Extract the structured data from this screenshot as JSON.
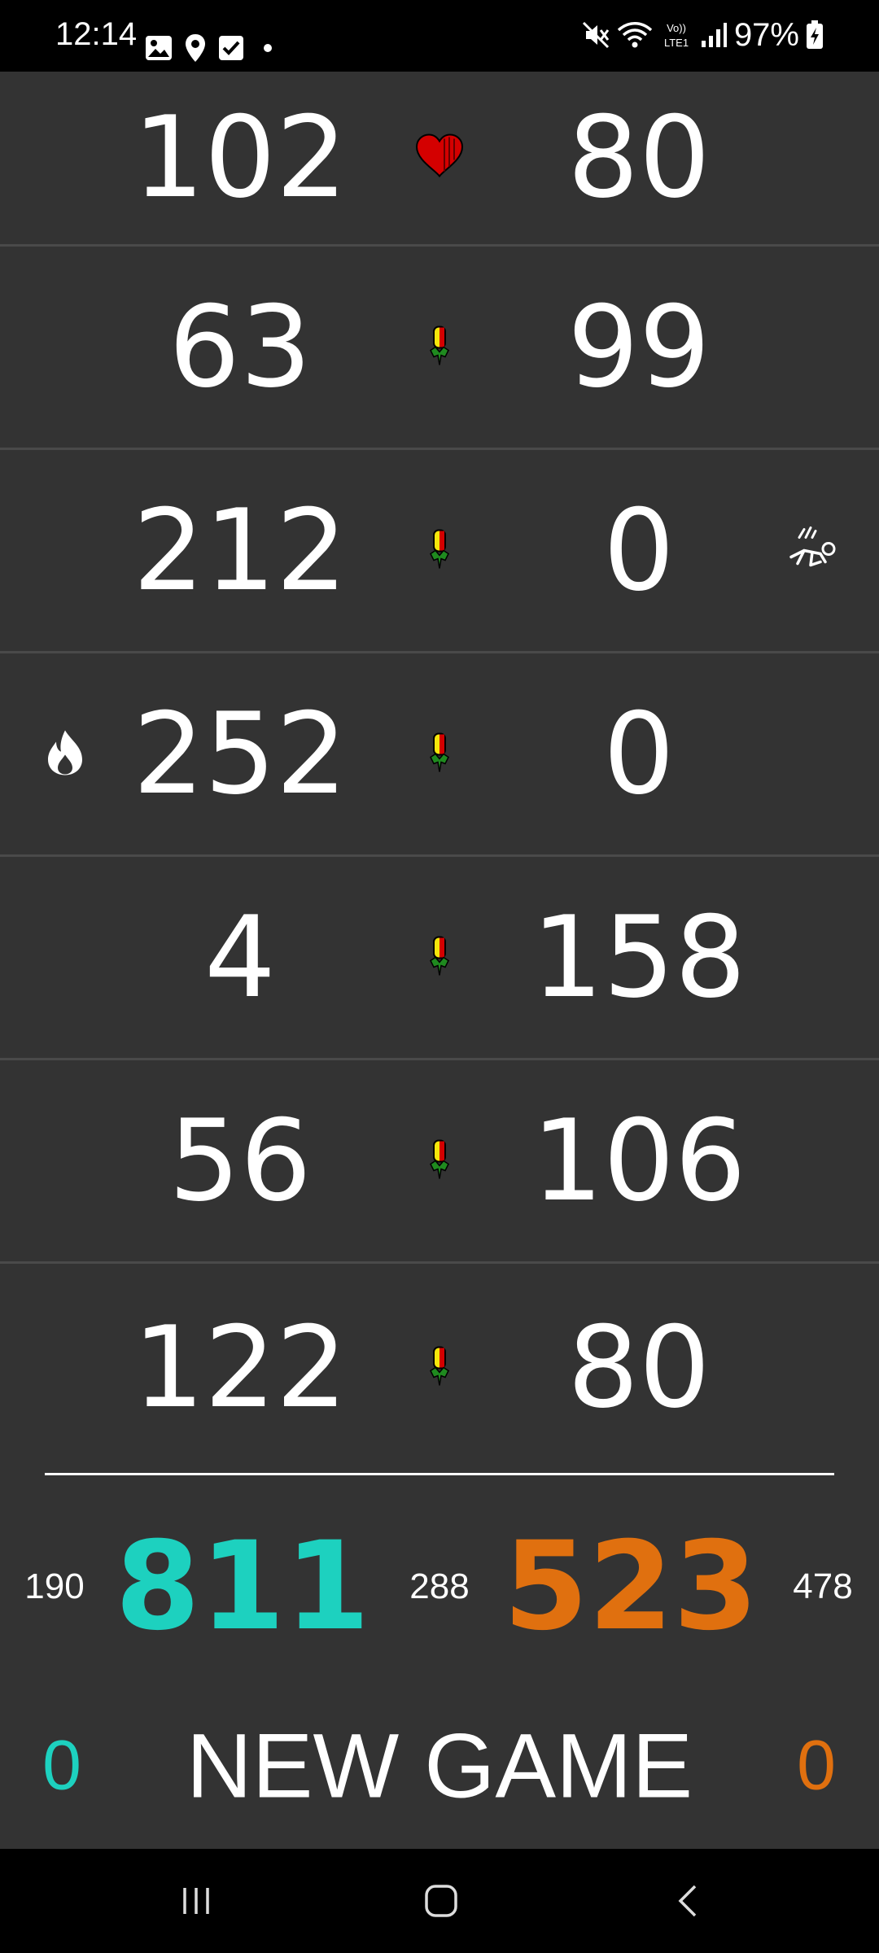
{
  "status_bar": {
    "time": "12:14",
    "battery": "97%",
    "icons": [
      "gallery-icon",
      "location-icon",
      "checkbox-icon",
      "dot-icon",
      "mute-icon",
      "wifi-icon",
      "volte-icon",
      "signal-icon",
      "battery-charging-icon"
    ]
  },
  "rounds": [
    {
      "left": "102",
      "right": "80",
      "icon": "heart-icon",
      "left_badge": "",
      "right_badge": ""
    },
    {
      "left": "63",
      "right": "99",
      "icon": "pepper-icon",
      "left_badge": "",
      "right_badge": ""
    },
    {
      "left": "212",
      "right": "0",
      "icon": "pepper-icon",
      "left_badge": "",
      "right_badge": "fallen-player-icon"
    },
    {
      "left": "252",
      "right": "0",
      "icon": "pepper-icon",
      "left_badge": "flame-icon",
      "right_badge": ""
    },
    {
      "left": "4",
      "right": "158",
      "icon": "pepper-icon",
      "left_badge": "",
      "right_badge": ""
    },
    {
      "left": "56",
      "right": "106",
      "icon": "pepper-icon",
      "left_badge": "",
      "right_badge": ""
    },
    {
      "left": "122",
      "right": "80",
      "icon": "pepper-icon",
      "left_badge": "",
      "right_badge": ""
    }
  ],
  "totals": {
    "left_small": "190",
    "left_total": "811",
    "middle_small": "288",
    "right_total": "523",
    "right_small": "478"
  },
  "footer": {
    "left_wins": "0",
    "new_game_label": "NEW GAME",
    "right_wins": "0"
  },
  "colors": {
    "team_left": "#1dd1bf",
    "team_right": "#e0700f",
    "background": "#333333",
    "heart": "#d40000"
  },
  "nav_bar": {
    "icons": [
      "recent-apps-icon",
      "home-icon",
      "back-icon"
    ]
  }
}
